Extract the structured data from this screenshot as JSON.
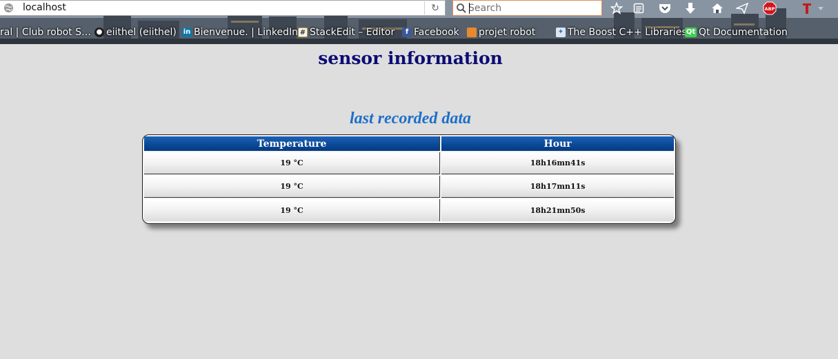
{
  "browser": {
    "url": "localhost",
    "search_placeholder": "Search",
    "toolbar_icons": [
      "star-icon",
      "reading-list-icon",
      "pocket-icon",
      "download-icon",
      "home-icon",
      "send-icon",
      "adblock-icon",
      "translate-icon",
      "chevron-down-icon"
    ],
    "bookmarks": [
      {
        "label": "ral | Club robot S…",
        "icon": "none"
      },
      {
        "label": "eiithel (eiithel)",
        "icon": "github-icon"
      },
      {
        "label": "Bienvenue. | LinkedIn",
        "icon": "linkedin-icon"
      },
      {
        "label": "StackEdit – Editor",
        "icon": "stackedit-icon"
      },
      {
        "label": "Facebook",
        "icon": "facebook-icon"
      },
      {
        "label": "projet robot",
        "icon": "folder-icon"
      },
      {
        "label": "The Boost C++ Libraries",
        "icon": "boost-icon"
      },
      {
        "label": "Qt Documentation",
        "icon": "qt-icon"
      }
    ],
    "adblock_label": "ABP"
  },
  "page": {
    "title": "sensor information",
    "subtitle": "last recorded data"
  },
  "table": {
    "headers": [
      "Temperature",
      "Hour"
    ],
    "rows": [
      [
        "19 °C",
        "18h16mn41s"
      ],
      [
        "19 °C",
        "18h17mn11s"
      ],
      [
        "19 °C",
        "18h21mn50s"
      ]
    ]
  },
  "colors": {
    "page_background": "#dedede",
    "title": "#0c0c74",
    "subtitle": "#1d6fc9",
    "header_background": "#0a4a99"
  }
}
